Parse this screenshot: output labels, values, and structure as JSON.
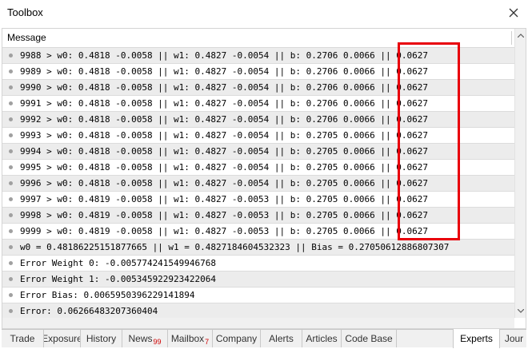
{
  "window": {
    "title": "Toolbox"
  },
  "list": {
    "column_header": "Message",
    "rows": [
      "9988 > w0: 0.4818 -0.0058 || w1: 0.4827 -0.0054 || b: 0.2706 0.0066 || 0.0627",
      "9989 > w0: 0.4818 -0.0058 || w1: 0.4827 -0.0054 || b: 0.2706 0.0066 || 0.0627",
      "9990 > w0: 0.4818 -0.0058 || w1: 0.4827 -0.0054 || b: 0.2706 0.0066 || 0.0627",
      "9991 > w0: 0.4818 -0.0058 || w1: 0.4827 -0.0054 || b: 0.2706 0.0066 || 0.0627",
      "9992 > w0: 0.4818 -0.0058 || w1: 0.4827 -0.0054 || b: 0.2706 0.0066 || 0.0627",
      "9993 > w0: 0.4818 -0.0058 || w1: 0.4827 -0.0054 || b: 0.2705 0.0066 || 0.0627",
      "9994 > w0: 0.4818 -0.0058 || w1: 0.4827 -0.0054 || b: 0.2705 0.0066 || 0.0627",
      "9995 > w0: 0.4818 -0.0058 || w1: 0.4827 -0.0054 || b: 0.2705 0.0066 || 0.0627",
      "9996 > w0: 0.4818 -0.0058 || w1: 0.4827 -0.0054 || b: 0.2705 0.0066 || 0.0627",
      "9997 > w0: 0.4819 -0.0058 || w1: 0.4827 -0.0053 || b: 0.2705 0.0066 || 0.0627",
      "9998 > w0: 0.4819 -0.0058 || w1: 0.4827 -0.0053 || b: 0.2705 0.0066 || 0.0627",
      "9999 > w0: 0.4819 -0.0058 || w1: 0.4827 -0.0053 || b: 0.2705 0.0066 || 0.0627",
      "w0 = 0.48186225151877665 || w1 = 0.4827184604532323 || Bias = 0.27050612886807307",
      "Error Weight 0: -0.00577424154994676​8",
      "Error Weight 1: -0.005345922923422064",
      "Error Bias: 0.006595039622914189​4",
      "Error: 0.06266483207360404"
    ]
  },
  "tabs": [
    {
      "label": "Trade",
      "badge": ""
    },
    {
      "label": "Exposure",
      "badge": ""
    },
    {
      "label": "History",
      "badge": ""
    },
    {
      "label": "News",
      "badge": "99"
    },
    {
      "label": "Mailbox",
      "badge": "7"
    },
    {
      "label": "Company",
      "badge": ""
    },
    {
      "label": "Alerts",
      "badge": ""
    },
    {
      "label": "Articles",
      "badge": ""
    },
    {
      "label": "Code Base",
      "badge": ""
    },
    {
      "label": "Experts",
      "badge": ""
    },
    {
      "label": "Jour",
      "badge": ""
    }
  ],
  "active_tab": "Experts",
  "colors": {
    "highlight_box": "#e8000b",
    "badge": "#d00000",
    "row_alt": "#ececec"
  }
}
